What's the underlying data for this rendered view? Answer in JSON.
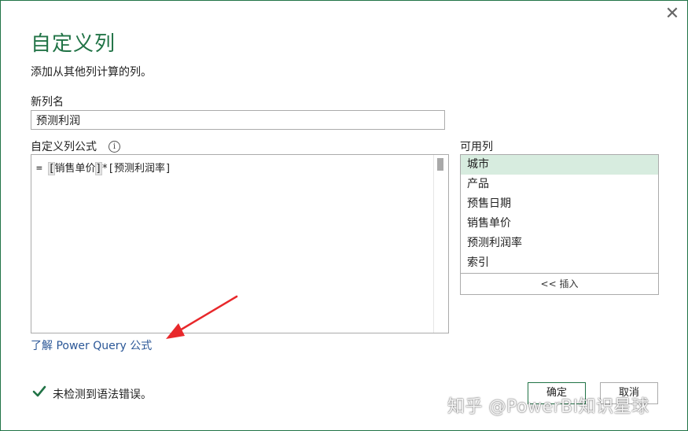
{
  "dialog": {
    "title": "自定义列",
    "subtitle": "添加从其他列计算的列。",
    "close_glyph": "✕"
  },
  "new_column": {
    "label": "新列名",
    "value": "预测利润"
  },
  "formula": {
    "label": "自定义列公式",
    "info_glyph": "i",
    "prefix": "= ",
    "open_bracket": "[",
    "column_ref": "销售单价",
    "close_bracket": "]",
    "rest": "*[预测利润率]"
  },
  "available_columns": {
    "label": "可用列",
    "items": [
      {
        "label": "城市",
        "selected": true
      },
      {
        "label": "产品"
      },
      {
        "label": "预售日期"
      },
      {
        "label": "销售单价"
      },
      {
        "label": "预测利润率"
      },
      {
        "label": "索引"
      }
    ],
    "insert_label": "<< 插入"
  },
  "learn_link": "了解 Power Query 公式",
  "status": {
    "message": "未检测到语法错误。",
    "icon": "check-icon",
    "color": "#217346"
  },
  "buttons": {
    "ok_label": "确定",
    "cancel_label": "取消"
  },
  "watermark": "知乎 @PowerBI知识星球",
  "colors": {
    "accent": "#217346",
    "selected_bg": "#d7ecdf",
    "link": "#2b5797",
    "annotation_arrow": "#e8282b"
  }
}
